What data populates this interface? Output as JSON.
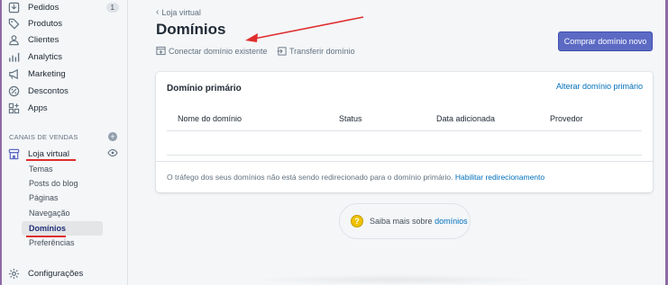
{
  "sidebar": {
    "items": [
      {
        "label": "Pedidos",
        "icon": "orders-icon",
        "badge": "1"
      },
      {
        "label": "Produtos",
        "icon": "tag-icon"
      },
      {
        "label": "Clientes",
        "icon": "customers-icon"
      },
      {
        "label": "Analytics",
        "icon": "analytics-icon"
      },
      {
        "label": "Marketing",
        "icon": "marketing-icon"
      },
      {
        "label": "Descontos",
        "icon": "discount-icon"
      },
      {
        "label": "Apps",
        "icon": "apps-icon"
      }
    ],
    "sales_channels_title": "CANAIS DE VENDAS",
    "online_store": "Loja virtual",
    "sub_items": [
      "Temas",
      "Posts do blog",
      "Páginas",
      "Navegação",
      "Domínios",
      "Preferências"
    ],
    "active_sub_item": "Domínios",
    "settings": "Configurações"
  },
  "header": {
    "breadcrumb": "Loja virtual",
    "title": "Domínios",
    "connect_label": "Conectar domínio existente",
    "transfer_label": "Transferir domínio",
    "buy_button": "Comprar domínio novo"
  },
  "card": {
    "title": "Domínio primário",
    "change_link": "Alterar domínio primário",
    "columns": [
      "Nome do domínio",
      "Status",
      "Data adicionada",
      "Provedor"
    ],
    "footer_text": "O tráfego dos seus domínios não está sendo redirecionado para o domínio primário.",
    "footer_link": "Habilitar redirecionamento"
  },
  "help": {
    "text": "Saiba mais sobre",
    "link": "domínios"
  },
  "colors": {
    "primary": "#5c6ac4",
    "link": "#006fbb",
    "annotation": "#e02d2d",
    "frame": "#8e6aa6"
  }
}
